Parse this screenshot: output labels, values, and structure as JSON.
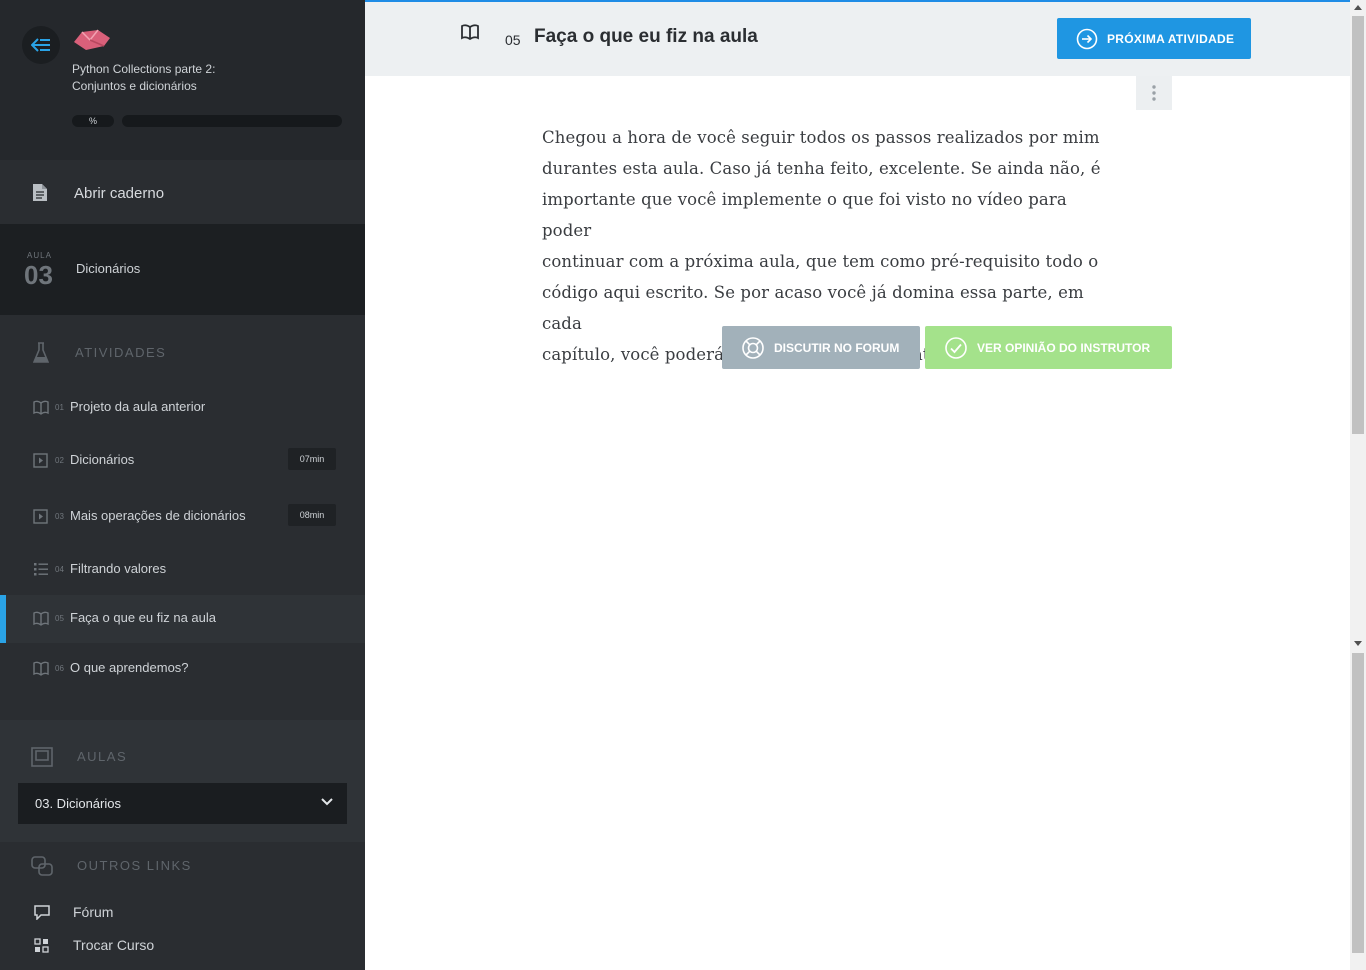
{
  "course": {
    "title_line1": "Python Collections parte 2:",
    "title_line2": "Conjuntos e dicionários",
    "progress_label": "%",
    "progress_fraction": 0.0
  },
  "notebook": {
    "label": "Abrir caderno"
  },
  "aula": {
    "small_label": "AULA",
    "number": "03",
    "name": "Dicionários"
  },
  "sections": {
    "activities": "ATIVIDADES",
    "lessons": "AULAS",
    "other_links": "OUTROS LINKS"
  },
  "activities": [
    {
      "num": "01",
      "label": "Projeto da aula anterior",
      "icon": "book-icon",
      "duration": ""
    },
    {
      "num": "02",
      "label": "Dicionários",
      "icon": "video-icon",
      "duration": "07min"
    },
    {
      "num": "03",
      "label": "Mais operações de dicionários",
      "icon": "video-icon",
      "duration": "08min"
    },
    {
      "num": "04",
      "label": "Filtrando valores",
      "icon": "list-icon",
      "duration": ""
    },
    {
      "num": "05",
      "label": "Faça o que eu fiz na aula",
      "icon": "book-icon",
      "duration": "",
      "active": true
    },
    {
      "num": "06",
      "label": "O que aprendemos?",
      "icon": "book-icon",
      "duration": ""
    }
  ],
  "lesson_select": {
    "selected": "03. Dicionários"
  },
  "links": [
    {
      "label": "Fórum",
      "icon": "chat-icon"
    },
    {
      "label": "Trocar Curso",
      "icon": "grid-icon"
    }
  ],
  "header": {
    "number": "05",
    "title": "Faça o que eu fiz na aula",
    "next_label": "PRÓXIMA ATIVIDADE"
  },
  "content": {
    "lines": [
      "Chegou a hora de você seguir todos os passos realizados por mim",
      "durantes esta aula. Caso já tenha feito, excelente. Se ainda não, é",
      "importante que você implemente o que foi visto no vídeo para poder",
      "continuar com a próxima aula, que tem como pré-requisito todo o",
      "código aqui escrito. Se por acaso você já domina essa parte, em cada",
      "capítulo, você poderá baixar o projeto feito até aquele ponto."
    ]
  },
  "actions": {
    "forum_label": "DISCUTIR NO FORUM",
    "instructor_label": "VER OPINIÃO DO INSTRUTOR"
  },
  "colors": {
    "accent": "#1f96e2",
    "sidebar_bg": "#2a2d31",
    "forum_btn": "#a2b1ba",
    "instructor_btn": "#a4e28b"
  }
}
